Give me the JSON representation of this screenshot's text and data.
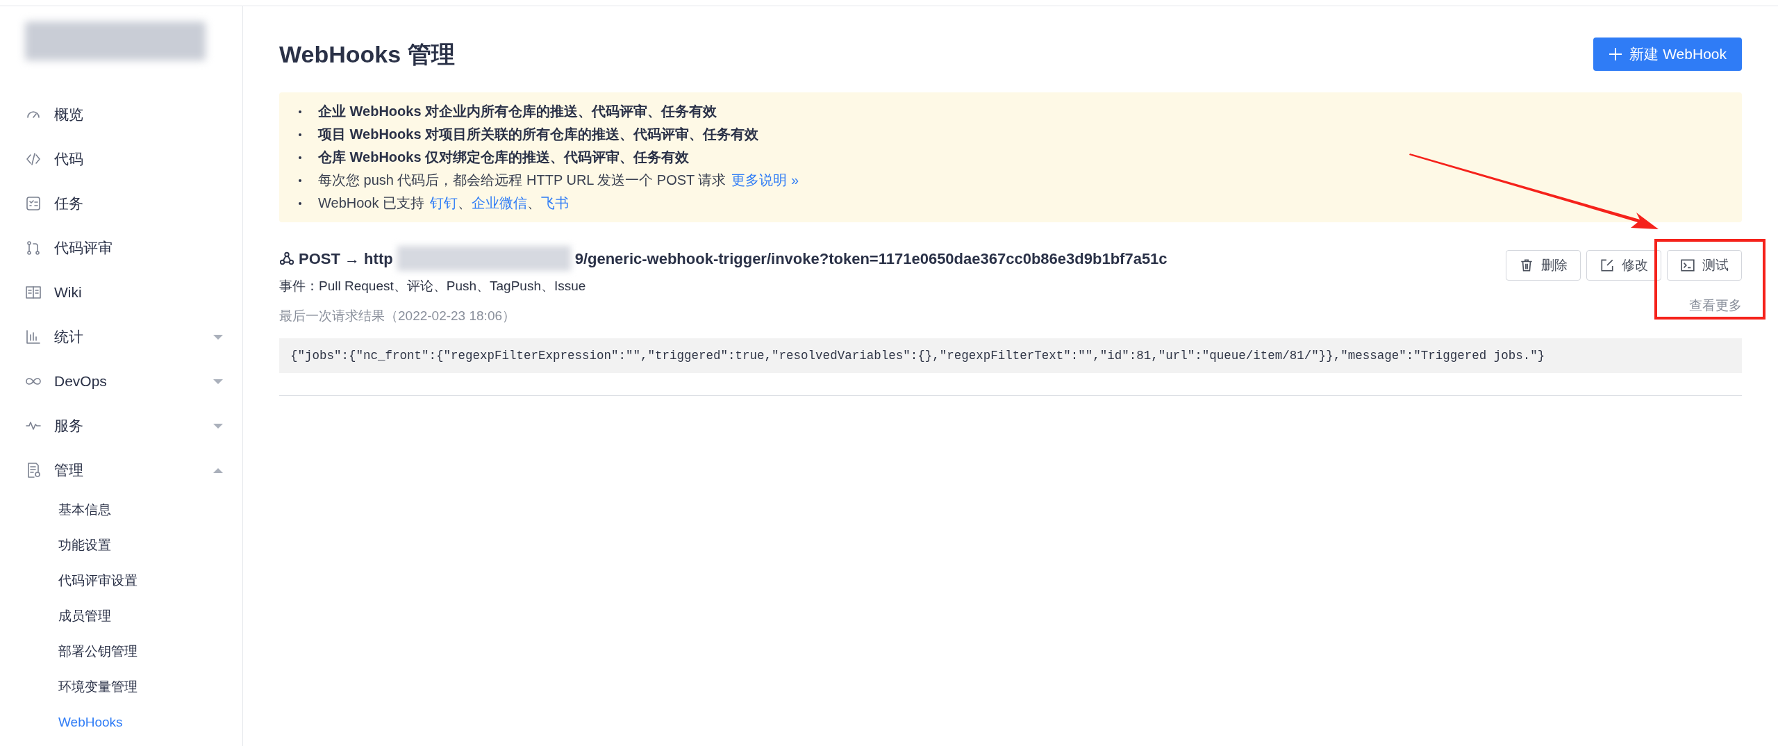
{
  "sidebar": {
    "items": [
      {
        "label": "概览"
      },
      {
        "label": "代码"
      },
      {
        "label": "任务"
      },
      {
        "label": "代码评审"
      },
      {
        "label": "Wiki"
      },
      {
        "label": "统计",
        "expanded": false
      },
      {
        "label": "DevOps",
        "expanded": false
      },
      {
        "label": "服务",
        "expanded": false
      },
      {
        "label": "管理",
        "expanded": true,
        "children": [
          {
            "label": "基本信息",
            "selected": false
          },
          {
            "label": "功能设置",
            "selected": false
          },
          {
            "label": "代码评审设置",
            "selected": false
          },
          {
            "label": "成员管理",
            "selected": false
          },
          {
            "label": "部署公钥管理",
            "selected": false
          },
          {
            "label": "环境变量管理",
            "selected": false
          },
          {
            "label": "WebHooks",
            "selected": true
          }
        ]
      }
    ]
  },
  "page": {
    "title": "WebHooks 管理",
    "new_button": "新建 WebHook"
  },
  "notice": [
    {
      "text": "企业 WebHooks 对企业内所有仓库的推送、代码评审、任务有效",
      "bold": true
    },
    {
      "text": "项目 WebHooks 对项目所关联的所有仓库的推送、代码评审、任务有效",
      "bold": true
    },
    {
      "text": "仓库 WebHooks 仅对绑定仓库的推送、代码评审、任务有效",
      "bold": true
    },
    {
      "text": "每次您 push 代码后，都会给远程 HTTP URL 发送一个 POST 请求",
      "bold": false,
      "parts": [
        {
          "text": "更多说明 »",
          "kind": "link"
        }
      ]
    },
    {
      "text": "WebHook 已支持",
      "bold": false,
      "parts": [
        {
          "text": "钉钉",
          "kind": "link"
        },
        {
          "text": "、",
          "kind": "plain"
        },
        {
          "text": "企业微信",
          "kind": "link"
        },
        {
          "text": "、",
          "kind": "plain"
        },
        {
          "text": "飞书",
          "kind": "link"
        }
      ]
    }
  ],
  "webhook": {
    "url_start": "POST → http",
    "url_end": "9/generic-webhook-trigger/invoke?token=1171e0650dae367cc0b86e3d9b1bf7a51c",
    "events": "事件：Pull Request、评论、Push、TagPush、Issue",
    "last_result": "最后一次请求结果（2022-02-23 18:06）",
    "more": "查看更多",
    "buttons": [
      {
        "label": "删除",
        "kind": "delete"
      },
      {
        "label": "修改",
        "kind": "edit"
      },
      {
        "label": "测试",
        "kind": "test"
      }
    ],
    "response": "{\"jobs\":{\"nc_front\":{\"regexpFilterExpression\":\"\",\"triggered\":true,\"resolvedVariables\":{},\"regexpFilterText\":\"\",\"id\":81,\"url\":\"queue/item/81/\"}},\"message\":\"Triggered jobs.\"}"
  }
}
